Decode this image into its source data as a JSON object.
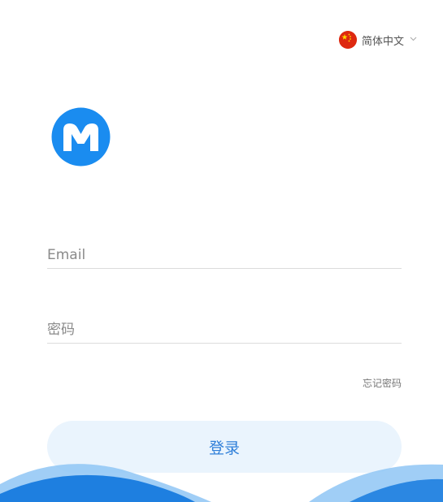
{
  "language": {
    "label": "简体中文",
    "flag_icon": "china-flag-icon",
    "chevron_icon": "chevron-down-icon"
  },
  "logo": {
    "icon": "m-logo-icon",
    "color": "#1a8cf0"
  },
  "form": {
    "email_placeholder": "Email",
    "email_value": "",
    "password_placeholder": "密码",
    "password_value": "",
    "forgot_label": "忘记密码",
    "login_label": "登录"
  },
  "colors": {
    "accent": "#2f7fd9",
    "button_bg": "#eaf4fd",
    "wave_dark": "#1e7fe0",
    "wave_light": "#8fc6f5"
  }
}
